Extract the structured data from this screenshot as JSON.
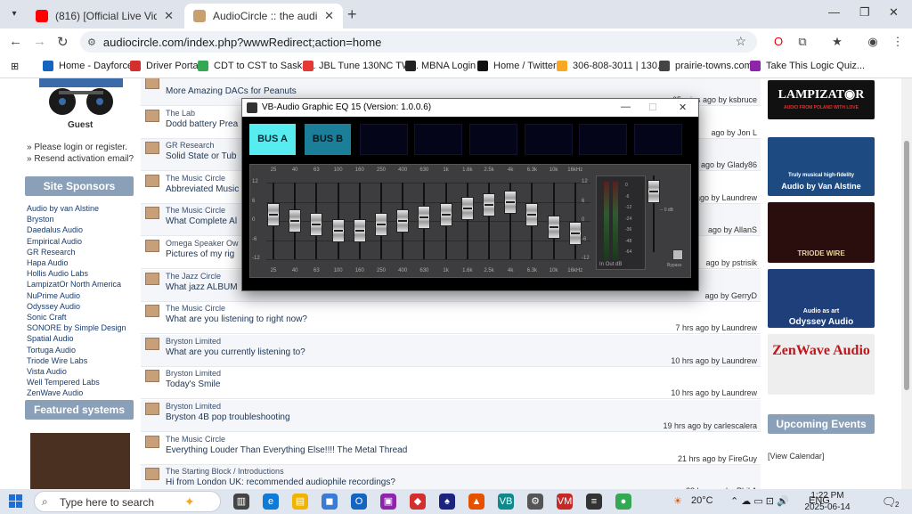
{
  "browser": {
    "tabs": [
      {
        "title": "(816) [Official Live Video] Unlu",
        "color": "#ff0000"
      },
      {
        "title": "AudioCircle :: the audio and hifi",
        "color": "#c8a070"
      }
    ],
    "url": "audiocircle.com/index.php?wwwRedirect;action=home",
    "bookmarks": [
      {
        "label": "Home - Dayforce",
        "color": "#1565c0"
      },
      {
        "label": "Driver Portal",
        "color": "#d32f2f"
      },
      {
        "label": "CDT to CST to Saska...",
        "color": "#34a853"
      },
      {
        "label": "JBL Tune 130NC TW...",
        "color": "#e53935"
      },
      {
        "label": "MBNA Login",
        "color": "#222222"
      },
      {
        "label": "Home / Twitter",
        "color": "#111111"
      },
      {
        "label": "306-808-3011 | 130...",
        "color": "#f9a825"
      },
      {
        "label": "prairie-towns.com",
        "color": "#444444"
      },
      {
        "label": "Take This Logic Quiz...",
        "color": "#8e24aa"
      }
    ]
  },
  "sidebar": {
    "guest": "Guest",
    "links": [
      "» Please login or register.",
      "» Resend activation email?"
    ],
    "sponsors_heading": "Site Sponsors",
    "sponsors": [
      "Audio by van Alstine",
      "Bryston",
      "Daedalus Audio",
      "Empirical Audio",
      "GR Research",
      "Hapa Audio",
      "Hollis Audio Labs",
      "LampizatOr North America",
      "NuPrime Audio",
      "Odyssey Audio",
      "Sonic Craft",
      "SONORE by Simple Design",
      "Spatial Audio",
      "Tortuga Audio",
      "Triode Wire Labs",
      "Vista Audio",
      "Well Tempered Labs",
      "ZenWave Audio"
    ],
    "featured_heading": "Featured systems"
  },
  "posts": [
    {
      "board": "",
      "subject": "More Amazing DACs for Peanuts",
      "time": "65 mins ago by ksbruce"
    },
    {
      "board": "The Lab",
      "subject": "Dodd battery Prea",
      "time": "ago by Jon L"
    },
    {
      "board": "GR Research",
      "subject": "Solid State or Tub",
      "time": "ago by Glady86"
    },
    {
      "board": "The Music Circle",
      "subject": "Abbreviated Music",
      "time": "ago by Laundrew"
    },
    {
      "board": "The Music Circle",
      "subject": "What Complete Al",
      "time": "ago by AllanS"
    },
    {
      "board": "Omega Speaker Ow",
      "subject": "Pictures of my rig",
      "time": "ago by pstrisik"
    },
    {
      "board": "The Jazz Circle",
      "subject": "What jazz ALBUM",
      "time": "ago by GerryD"
    },
    {
      "board": "The Music Circle",
      "subject": "What are you listening to right now?",
      "time": "7 hrs ago by Laundrew"
    },
    {
      "board": "Bryston Limited",
      "subject": "What are you currently listening to?",
      "time": "10 hrs ago by Laundrew"
    },
    {
      "board": "Bryston Limited",
      "subject": "Today's Smile",
      "time": "10 hrs ago by Laundrew"
    },
    {
      "board": "Bryston Limited",
      "subject": "Bryston 4B pop troubleshooting",
      "time": "19 hrs ago by carlescalera"
    },
    {
      "board": "The Music Circle",
      "subject": "Everything Louder Than Everything Else!!!! The Metal Thread",
      "time": "21 hrs ago by FireGuy"
    },
    {
      "board": "The Starting Block / Introductions",
      "subject": "Hi from London UK: recommended audiophile recordings?",
      "time": "23 hrs ago by Phil A"
    }
  ],
  "right": {
    "ads": [
      {
        "title": "LAMPIZAT◉R",
        "sub": "AUDIO FROM POLAND WITH LOVE",
        "bg": "#111111"
      },
      {
        "title": "Audio by Van Alstine",
        "sub": "Truly musical high-fidelity",
        "bg": "#1d4a80"
      },
      {
        "title": "TRIODE WIRE",
        "sub": "",
        "bg": "#2a0e0e"
      },
      {
        "title": "Odyssey Audio",
        "sub": "Audio as art",
        "bg": "#1f3f7a"
      },
      {
        "title": "ZenWave Audio",
        "sub": "",
        "bg": "#eeeeee"
      }
    ],
    "upcoming": "Upcoming Events",
    "calendar": "[View Calendar]"
  },
  "eq": {
    "title": "VB-Audio Graphic EQ 15 (Version: 1.0.0.6)",
    "bus_a": "BUS A",
    "bus_b": "BUS B",
    "freqs": [
      "25",
      "40",
      "63",
      "100",
      "160",
      "250",
      "400",
      "630",
      "1k",
      "1.6k",
      "2.5k",
      "4k",
      "6.3k",
      "10k",
      "16kHz"
    ],
    "gains": [
      2,
      0,
      -1,
      -3,
      -3,
      -1,
      0,
      1,
      2,
      4,
      5,
      6,
      2,
      -2,
      -4
    ],
    "db_ticks": [
      "12",
      "6",
      "0",
      "-6",
      "-12"
    ],
    "meter_labels": [
      "In",
      "Out",
      "dB"
    ],
    "meter_scale": [
      "0",
      "-6",
      "-12",
      "-24",
      "-36",
      "-48",
      "-64"
    ],
    "gain_label": "-- 0 dB",
    "bypass": "Bypass"
  },
  "taskbar": {
    "search": "Type here to search",
    "weather": "20°C",
    "lang": "ENG",
    "time": "1:22 PM",
    "date": "2025-06-14",
    "notifications": "2",
    "apps": [
      {
        "name": "task-view",
        "color": "#444444",
        "glyph": "▥"
      },
      {
        "name": "edge",
        "color": "#0f7bd6",
        "glyph": "e"
      },
      {
        "name": "file-explorer",
        "color": "#f0b400",
        "glyph": "▤"
      },
      {
        "name": "store",
        "color": "#3a7bd5",
        "glyph": "◼"
      },
      {
        "name": "outlook",
        "color": "#1565c0",
        "glyph": "O"
      },
      {
        "name": "photos",
        "color": "#8e24aa",
        "glyph": "▣"
      },
      {
        "name": "shield",
        "color": "#d32f2f",
        "glyph": "◆"
      },
      {
        "name": "solitaire",
        "color": "#1a237e",
        "glyph": "♠"
      },
      {
        "name": "winamp",
        "color": "#e65100",
        "glyph": "▲"
      },
      {
        "name": "voicemeeter",
        "color": "#0f8a8a",
        "glyph": "VB"
      },
      {
        "name": "settings",
        "color": "#555555",
        "glyph": "⚙"
      },
      {
        "name": "voice-meeter2",
        "color": "#c62828",
        "glyph": "VM"
      },
      {
        "name": "eq",
        "color": "#333333",
        "glyph": "≡"
      },
      {
        "name": "chrome",
        "color": "#34a853",
        "glyph": "●"
      }
    ]
  }
}
